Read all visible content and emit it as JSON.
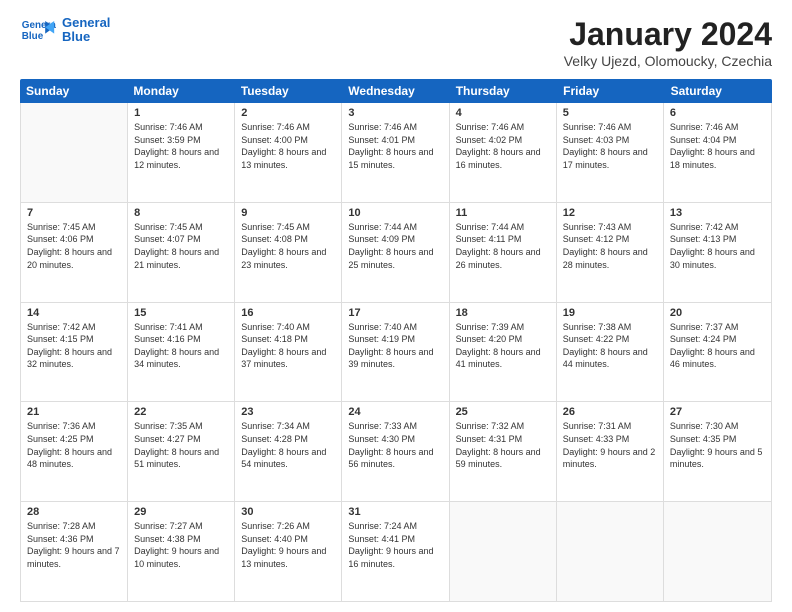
{
  "logo": {
    "line1": "General",
    "line2": "Blue"
  },
  "title": "January 2024",
  "subtitle": "Velky Ujezd, Olomoucky, Czechia",
  "weekdays": [
    "Sunday",
    "Monday",
    "Tuesday",
    "Wednesday",
    "Thursday",
    "Friday",
    "Saturday"
  ],
  "weeks": [
    [
      {
        "day": "",
        "sunrise": "",
        "sunset": "",
        "daylight": ""
      },
      {
        "day": "1",
        "sunrise": "Sunrise: 7:46 AM",
        "sunset": "Sunset: 3:59 PM",
        "daylight": "Daylight: 8 hours and 12 minutes."
      },
      {
        "day": "2",
        "sunrise": "Sunrise: 7:46 AM",
        "sunset": "Sunset: 4:00 PM",
        "daylight": "Daylight: 8 hours and 13 minutes."
      },
      {
        "day": "3",
        "sunrise": "Sunrise: 7:46 AM",
        "sunset": "Sunset: 4:01 PM",
        "daylight": "Daylight: 8 hours and 15 minutes."
      },
      {
        "day": "4",
        "sunrise": "Sunrise: 7:46 AM",
        "sunset": "Sunset: 4:02 PM",
        "daylight": "Daylight: 8 hours and 16 minutes."
      },
      {
        "day": "5",
        "sunrise": "Sunrise: 7:46 AM",
        "sunset": "Sunset: 4:03 PM",
        "daylight": "Daylight: 8 hours and 17 minutes."
      },
      {
        "day": "6",
        "sunrise": "Sunrise: 7:46 AM",
        "sunset": "Sunset: 4:04 PM",
        "daylight": "Daylight: 8 hours and 18 minutes."
      }
    ],
    [
      {
        "day": "7",
        "sunrise": "Sunrise: 7:45 AM",
        "sunset": "Sunset: 4:06 PM",
        "daylight": "Daylight: 8 hours and 20 minutes."
      },
      {
        "day": "8",
        "sunrise": "Sunrise: 7:45 AM",
        "sunset": "Sunset: 4:07 PM",
        "daylight": "Daylight: 8 hours and 21 minutes."
      },
      {
        "day": "9",
        "sunrise": "Sunrise: 7:45 AM",
        "sunset": "Sunset: 4:08 PM",
        "daylight": "Daylight: 8 hours and 23 minutes."
      },
      {
        "day": "10",
        "sunrise": "Sunrise: 7:44 AM",
        "sunset": "Sunset: 4:09 PM",
        "daylight": "Daylight: 8 hours and 25 minutes."
      },
      {
        "day": "11",
        "sunrise": "Sunrise: 7:44 AM",
        "sunset": "Sunset: 4:11 PM",
        "daylight": "Daylight: 8 hours and 26 minutes."
      },
      {
        "day": "12",
        "sunrise": "Sunrise: 7:43 AM",
        "sunset": "Sunset: 4:12 PM",
        "daylight": "Daylight: 8 hours and 28 minutes."
      },
      {
        "day": "13",
        "sunrise": "Sunrise: 7:42 AM",
        "sunset": "Sunset: 4:13 PM",
        "daylight": "Daylight: 8 hours and 30 minutes."
      }
    ],
    [
      {
        "day": "14",
        "sunrise": "Sunrise: 7:42 AM",
        "sunset": "Sunset: 4:15 PM",
        "daylight": "Daylight: 8 hours and 32 minutes."
      },
      {
        "day": "15",
        "sunrise": "Sunrise: 7:41 AM",
        "sunset": "Sunset: 4:16 PM",
        "daylight": "Daylight: 8 hours and 34 minutes."
      },
      {
        "day": "16",
        "sunrise": "Sunrise: 7:40 AM",
        "sunset": "Sunset: 4:18 PM",
        "daylight": "Daylight: 8 hours and 37 minutes."
      },
      {
        "day": "17",
        "sunrise": "Sunrise: 7:40 AM",
        "sunset": "Sunset: 4:19 PM",
        "daylight": "Daylight: 8 hours and 39 minutes."
      },
      {
        "day": "18",
        "sunrise": "Sunrise: 7:39 AM",
        "sunset": "Sunset: 4:20 PM",
        "daylight": "Daylight: 8 hours and 41 minutes."
      },
      {
        "day": "19",
        "sunrise": "Sunrise: 7:38 AM",
        "sunset": "Sunset: 4:22 PM",
        "daylight": "Daylight: 8 hours and 44 minutes."
      },
      {
        "day": "20",
        "sunrise": "Sunrise: 7:37 AM",
        "sunset": "Sunset: 4:24 PM",
        "daylight": "Daylight: 8 hours and 46 minutes."
      }
    ],
    [
      {
        "day": "21",
        "sunrise": "Sunrise: 7:36 AM",
        "sunset": "Sunset: 4:25 PM",
        "daylight": "Daylight: 8 hours and 48 minutes."
      },
      {
        "day": "22",
        "sunrise": "Sunrise: 7:35 AM",
        "sunset": "Sunset: 4:27 PM",
        "daylight": "Daylight: 8 hours and 51 minutes."
      },
      {
        "day": "23",
        "sunrise": "Sunrise: 7:34 AM",
        "sunset": "Sunset: 4:28 PM",
        "daylight": "Daylight: 8 hours and 54 minutes."
      },
      {
        "day": "24",
        "sunrise": "Sunrise: 7:33 AM",
        "sunset": "Sunset: 4:30 PM",
        "daylight": "Daylight: 8 hours and 56 minutes."
      },
      {
        "day": "25",
        "sunrise": "Sunrise: 7:32 AM",
        "sunset": "Sunset: 4:31 PM",
        "daylight": "Daylight: 8 hours and 59 minutes."
      },
      {
        "day": "26",
        "sunrise": "Sunrise: 7:31 AM",
        "sunset": "Sunset: 4:33 PM",
        "daylight": "Daylight: 9 hours and 2 minutes."
      },
      {
        "day": "27",
        "sunrise": "Sunrise: 7:30 AM",
        "sunset": "Sunset: 4:35 PM",
        "daylight": "Daylight: 9 hours and 5 minutes."
      }
    ],
    [
      {
        "day": "28",
        "sunrise": "Sunrise: 7:28 AM",
        "sunset": "Sunset: 4:36 PM",
        "daylight": "Daylight: 9 hours and 7 minutes."
      },
      {
        "day": "29",
        "sunrise": "Sunrise: 7:27 AM",
        "sunset": "Sunset: 4:38 PM",
        "daylight": "Daylight: 9 hours and 10 minutes."
      },
      {
        "day": "30",
        "sunrise": "Sunrise: 7:26 AM",
        "sunset": "Sunset: 4:40 PM",
        "daylight": "Daylight: 9 hours and 13 minutes."
      },
      {
        "day": "31",
        "sunrise": "Sunrise: 7:24 AM",
        "sunset": "Sunset: 4:41 PM",
        "daylight": "Daylight: 9 hours and 16 minutes."
      },
      {
        "day": "",
        "sunrise": "",
        "sunset": "",
        "daylight": ""
      },
      {
        "day": "",
        "sunrise": "",
        "sunset": "",
        "daylight": ""
      },
      {
        "day": "",
        "sunrise": "",
        "sunset": "",
        "daylight": ""
      }
    ]
  ]
}
